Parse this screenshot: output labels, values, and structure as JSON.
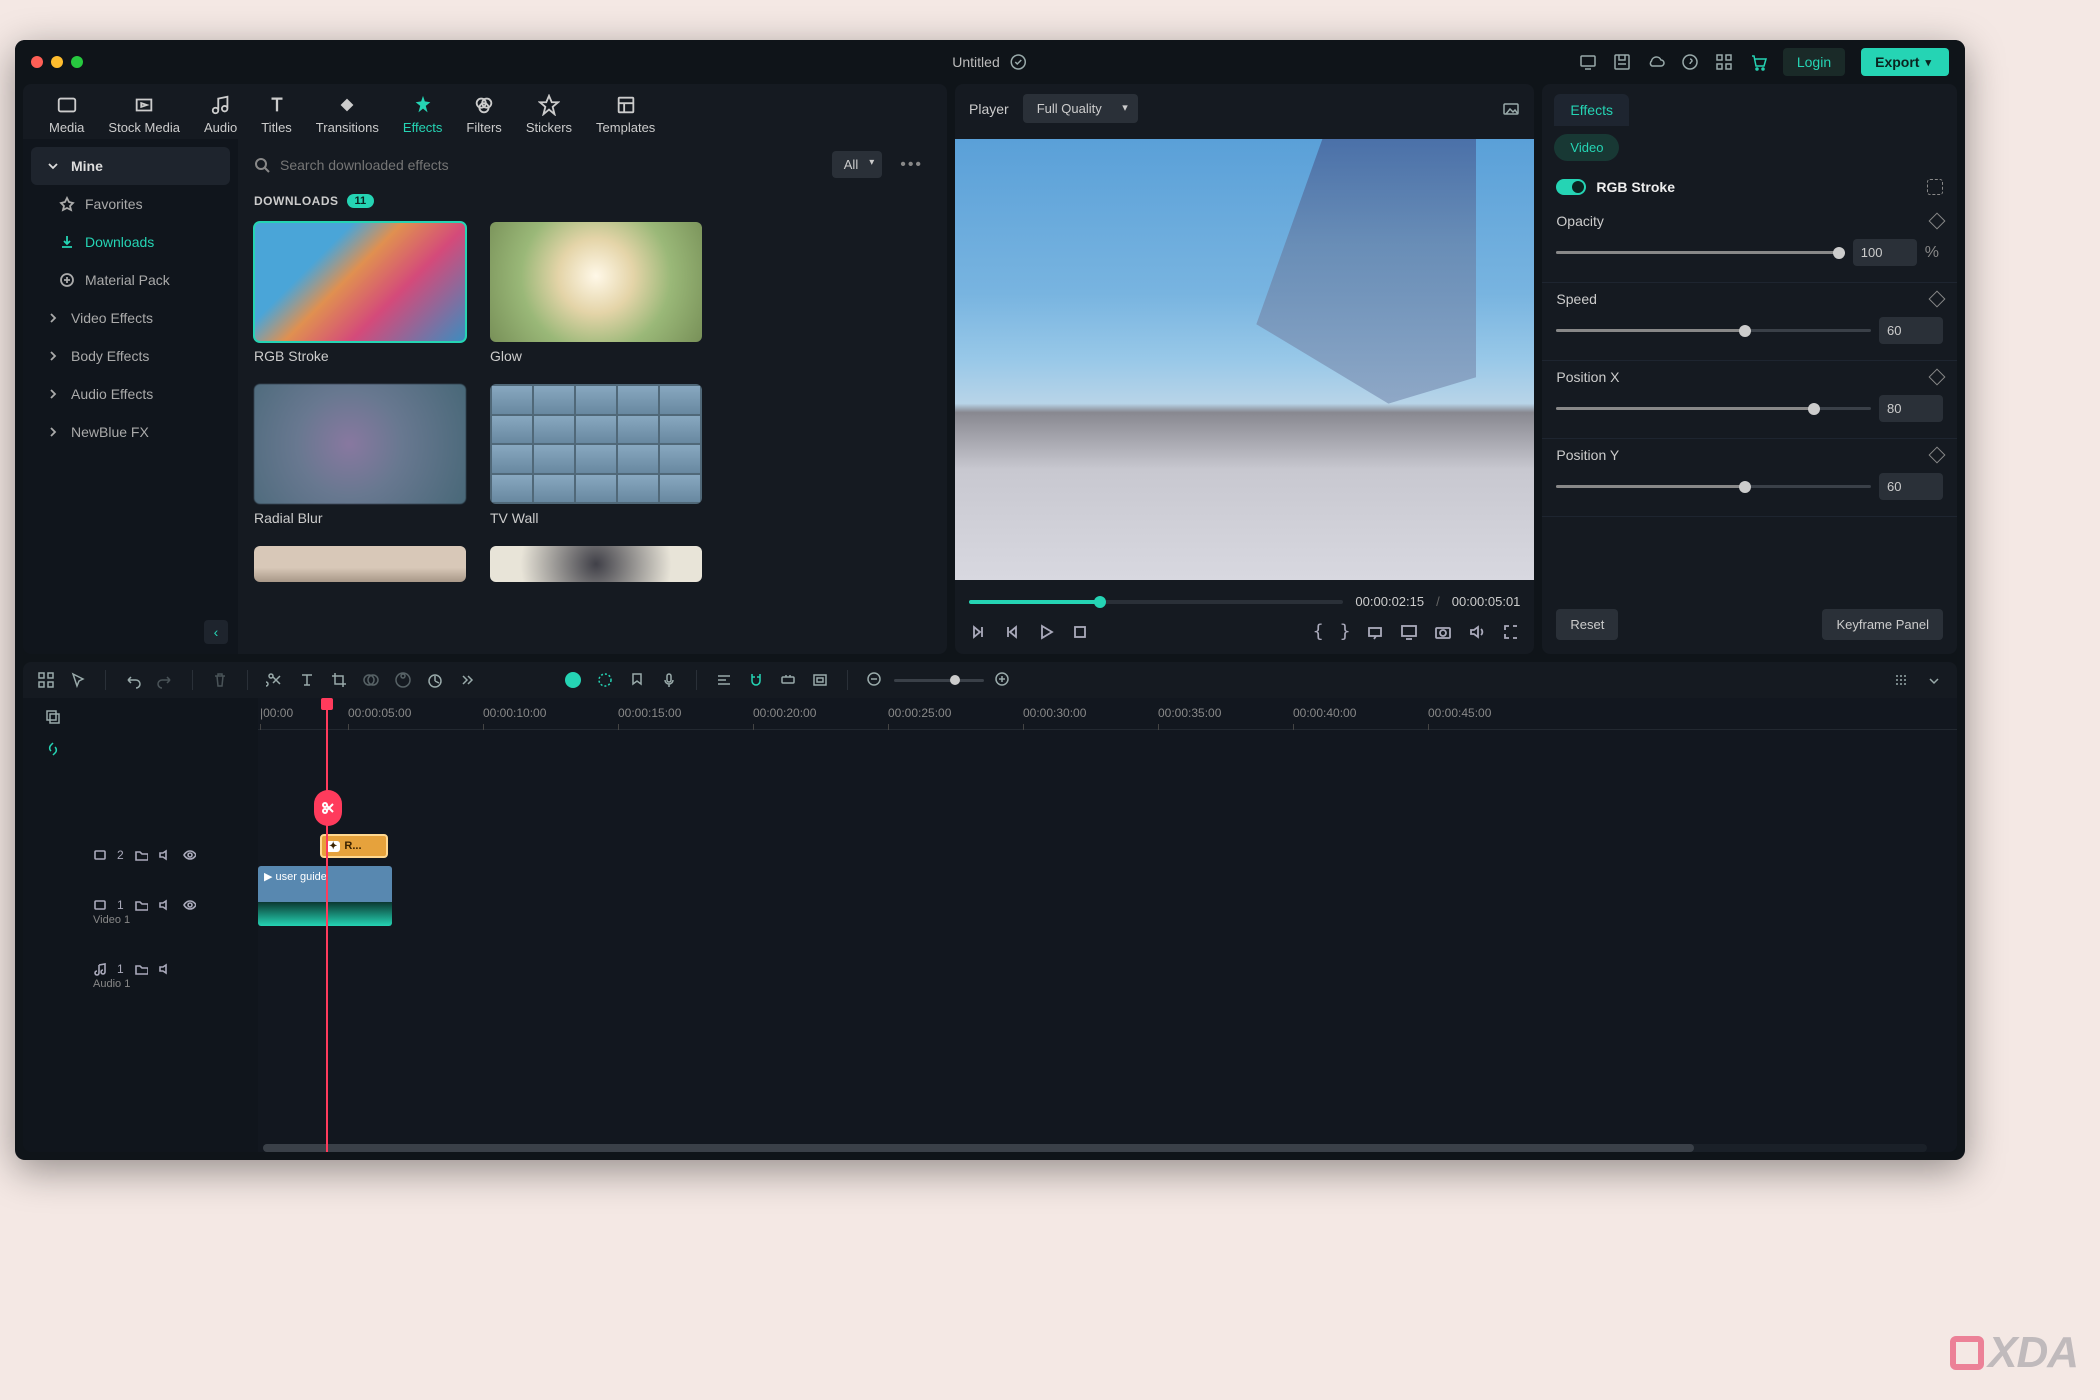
{
  "titlebar": {
    "title": "Untitled",
    "login": "Login",
    "export": "Export"
  },
  "tabs": [
    "Media",
    "Stock Media",
    "Audio",
    "Titles",
    "Transitions",
    "Effects",
    "Filters",
    "Stickers",
    "Templates"
  ],
  "active_tab": "Effects",
  "sidebar": {
    "mine": "Mine",
    "favorites": "Favorites",
    "downloads": "Downloads",
    "material_pack": "Material Pack",
    "video_effects": "Video Effects",
    "body_effects": "Body Effects",
    "audio_effects": "Audio Effects",
    "newblue": "NewBlue FX"
  },
  "search": {
    "placeholder": "Search downloaded effects",
    "filter": "All"
  },
  "downloads": {
    "label": "DOWNLOADS",
    "count": "11"
  },
  "cards": [
    {
      "label": "RGB Stroke"
    },
    {
      "label": "Glow"
    },
    {
      "label": "Radial Blur"
    },
    {
      "label": "TV Wall"
    }
  ],
  "player": {
    "label": "Player",
    "quality": "Full Quality",
    "current": "00:00:02:15",
    "total": "00:00:05:01",
    "sep": "/"
  },
  "effects_panel": {
    "tab": "Effects",
    "subtab": "Video",
    "title": "RGB Stroke",
    "props": {
      "opacity": {
        "label": "Opacity",
        "value": "100",
        "unit": "%",
        "pct": 98
      },
      "speed": {
        "label": "Speed",
        "value": "60",
        "pct": 60
      },
      "posx": {
        "label": "Position X",
        "value": "80",
        "pct": 82
      },
      "posy": {
        "label": "Position Y",
        "value": "60",
        "pct": 60
      }
    },
    "reset": "Reset",
    "keyframe": "Keyframe Panel"
  },
  "timeline": {
    "marks": [
      "|00:00",
      "00:00:05:00",
      "00:00:10:00",
      "00:00:15:00",
      "00:00:20:00",
      "00:00:25:00",
      "00:00:30:00",
      "00:00:35:00",
      "00:00:40:00",
      "00:00:45:00"
    ],
    "fx_clip": "R...",
    "video_clip": "user guide",
    "tracks": {
      "t2": "2",
      "t1_video": "1",
      "video_label": "Video 1",
      "t1_audio": "1",
      "audio_label": "Audio 1"
    }
  },
  "watermark": "XDA"
}
